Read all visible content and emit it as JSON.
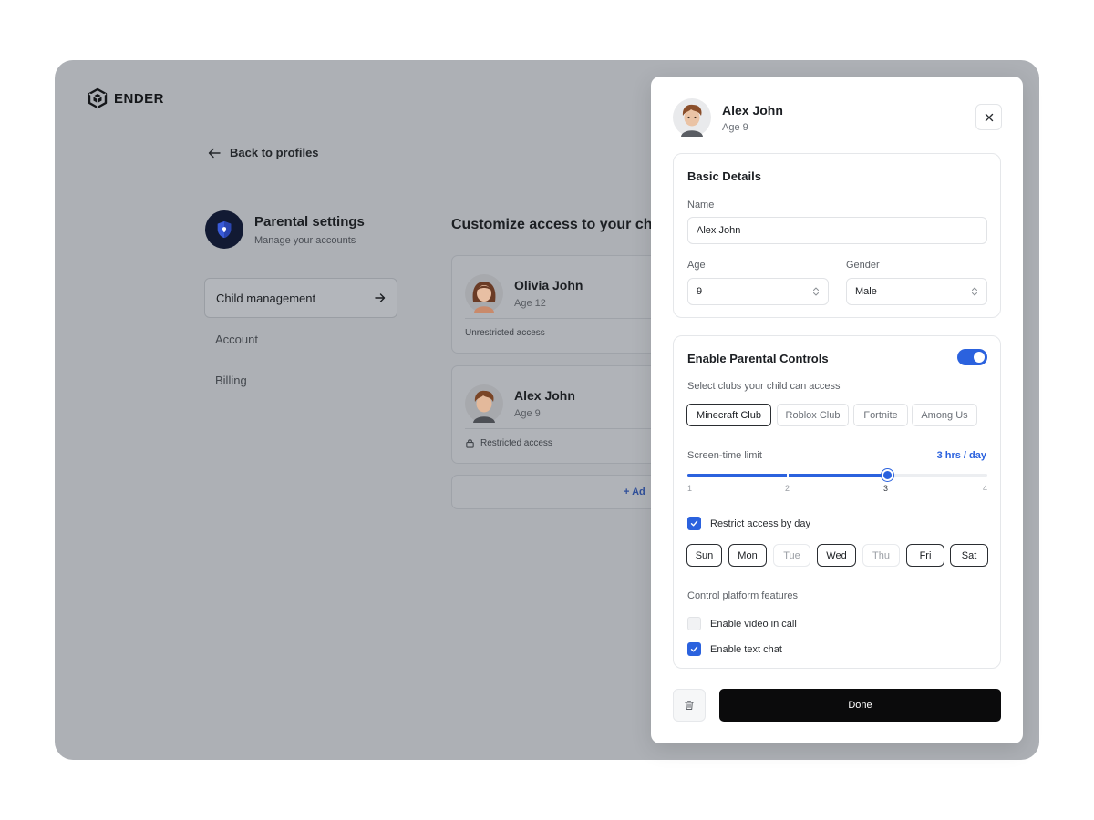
{
  "app": {
    "brand": "ENDER"
  },
  "background": {
    "back_label": "Back to profiles",
    "settings": {
      "title": "Parental settings",
      "subtitle": "Manage your accounts"
    },
    "nav": [
      {
        "label": "Child management",
        "active": true
      },
      {
        "label": "Account",
        "active": false
      },
      {
        "label": "Billing",
        "active": false
      }
    ],
    "customize_title": "Customize access to your child",
    "children": [
      {
        "name": "Olivia John",
        "age": "Age 12",
        "access": "Unrestricted access",
        "locked": false
      },
      {
        "name": "Alex John",
        "age": "Age 9",
        "access": "Restricted access",
        "locked": true
      }
    ],
    "add_label": "+ Ad"
  },
  "panel": {
    "name": "Alex John",
    "age": "Age 9",
    "basic": {
      "title": "Basic Details",
      "name_label": "Name",
      "name_value": "Alex John",
      "age_label": "Age",
      "age_value": "9",
      "gender_label": "Gender",
      "gender_value": "Male"
    },
    "controls": {
      "title": "Enable Parental Controls",
      "enabled": true,
      "clubs_label": "Select clubs your child can access",
      "clubs": [
        {
          "label": "Minecraft Club",
          "selected": true
        },
        {
          "label": "Roblox Club",
          "selected": false
        },
        {
          "label": "Fortnite",
          "selected": false
        },
        {
          "label": "Among Us",
          "selected": false
        }
      ],
      "screen_time_label": "Screen-time limit",
      "screen_time_value": "3 hrs / day",
      "slider": {
        "min": 1,
        "max": 4,
        "value": 3,
        "ticks": [
          "1",
          "2",
          "3",
          "4"
        ]
      },
      "restrict_label": "Restrict access by day",
      "restrict_checked": true,
      "days": [
        {
          "label": "Sun",
          "selected": true
        },
        {
          "label": "Mon",
          "selected": true
        },
        {
          "label": "Tue",
          "selected": false
        },
        {
          "label": "Wed",
          "selected": true
        },
        {
          "label": "Thu",
          "selected": false
        },
        {
          "label": "Fri",
          "selected": true
        },
        {
          "label": "Sat",
          "selected": true
        }
      ],
      "features_label": "Control platform features",
      "features": [
        {
          "label": "Enable video in call",
          "checked": false
        },
        {
          "label": "Enable text chat",
          "checked": true
        }
      ]
    },
    "done_label": "Done"
  },
  "colors": {
    "accent": "#2b62de",
    "primary_button": "#0b0b0c",
    "overlay": "#adb0b5"
  },
  "icons": [
    "ender-logo-icon",
    "arrow-left-icon",
    "shield-icon",
    "arrow-right-icon",
    "lock-icon",
    "close-icon",
    "chevron-updown-icon",
    "check-icon",
    "trash-icon"
  ]
}
